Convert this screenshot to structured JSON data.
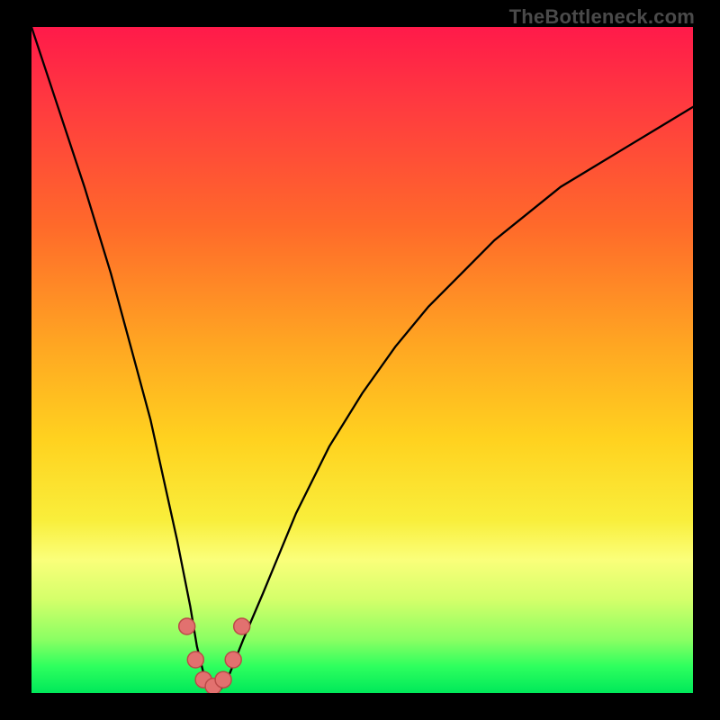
{
  "watermark": "TheBottleneck.com",
  "chart_data": {
    "type": "line",
    "title": "",
    "xlabel": "",
    "ylabel": "",
    "xlim": [
      0,
      100
    ],
    "ylim": [
      0,
      100
    ],
    "series": [
      {
        "name": "curve",
        "x": [
          0,
          4,
          8,
          12,
          15,
          18,
          20,
          22,
          24,
          25,
          26,
          27,
          28,
          29,
          30,
          32,
          35,
          40,
          45,
          50,
          55,
          60,
          65,
          70,
          75,
          80,
          85,
          90,
          95,
          100
        ],
        "y": [
          100,
          88,
          76,
          63,
          52,
          41,
          32,
          23,
          13,
          7,
          3,
          1,
          0,
          1,
          3,
          8,
          15,
          27,
          37,
          45,
          52,
          58,
          63,
          68,
          72,
          76,
          79,
          82,
          85,
          88
        ]
      }
    ],
    "markers": [
      {
        "x": 23.5,
        "y": 10,
        "r": 2.2
      },
      {
        "x": 24.8,
        "y": 5,
        "r": 2.2
      },
      {
        "x": 26.0,
        "y": 2,
        "r": 2.2
      },
      {
        "x": 27.5,
        "y": 1,
        "r": 2.2
      },
      {
        "x": 29.0,
        "y": 2,
        "r": 2.2
      },
      {
        "x": 30.5,
        "y": 5,
        "r": 2.2
      },
      {
        "x": 31.8,
        "y": 10,
        "r": 2.2
      }
    ],
    "gradient_stops": [
      {
        "pos": 0,
        "color": "#ff1a4a"
      },
      {
        "pos": 12,
        "color": "#ff3b3f"
      },
      {
        "pos": 30,
        "color": "#ff6a2a"
      },
      {
        "pos": 48,
        "color": "#ffa722"
      },
      {
        "pos": 62,
        "color": "#ffd21f"
      },
      {
        "pos": 74,
        "color": "#f9ee3b"
      },
      {
        "pos": 80,
        "color": "#faff7a"
      },
      {
        "pos": 86,
        "color": "#d4ff6a"
      },
      {
        "pos": 92,
        "color": "#8aff63"
      },
      {
        "pos": 96,
        "color": "#2eff5e"
      },
      {
        "pos": 100,
        "color": "#00e85a"
      }
    ]
  }
}
